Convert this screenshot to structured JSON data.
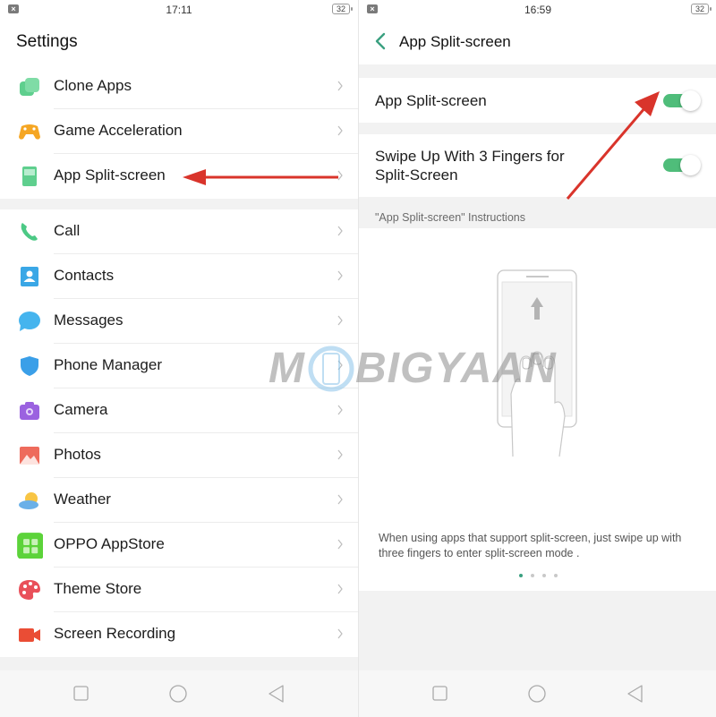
{
  "left": {
    "status": {
      "time": "17:11",
      "battery": "32"
    },
    "title": "Settings",
    "groups": [
      {
        "items": [
          {
            "label": "Clone Apps",
            "icon": "clone-apps-icon"
          },
          {
            "label": "Game Acceleration",
            "icon": "game-acceleration-icon"
          },
          {
            "label": "App Split-screen",
            "icon": "split-screen-icon"
          }
        ]
      },
      {
        "items": [
          {
            "label": "Call",
            "icon": "phone-icon"
          },
          {
            "label": "Contacts",
            "icon": "contacts-icon"
          },
          {
            "label": "Messages",
            "icon": "messages-icon"
          },
          {
            "label": "Phone Manager",
            "icon": "shield-icon"
          },
          {
            "label": "Camera",
            "icon": "camera-icon"
          },
          {
            "label": "Photos",
            "icon": "photos-icon"
          },
          {
            "label": "Weather",
            "icon": "weather-icon"
          },
          {
            "label": "OPPO AppStore",
            "icon": "appstore-icon"
          },
          {
            "label": "Theme Store",
            "icon": "palette-icon"
          },
          {
            "label": "Screen Recording",
            "icon": "video-camera-icon"
          }
        ]
      }
    ]
  },
  "right": {
    "status": {
      "time": "16:59",
      "battery": "32"
    },
    "title": "App Split-screen",
    "toggles": [
      {
        "label": "App Split-screen",
        "on": true
      },
      {
        "label": "Swipe Up With 3 Fingers for Split-Screen",
        "on": true
      }
    ],
    "caption": "\"App Split-screen\" Instructions",
    "description": "When using apps that support split-screen, just swipe up with three fingers to enter split-screen mode .",
    "pager": {
      "pages": 4,
      "current": 1
    }
  },
  "watermark": "MOBIGYAAN",
  "colors": {
    "accent": "#3aa080",
    "toggle_on": "#4fbd7a",
    "annotation_arrow": "#d9342b"
  }
}
